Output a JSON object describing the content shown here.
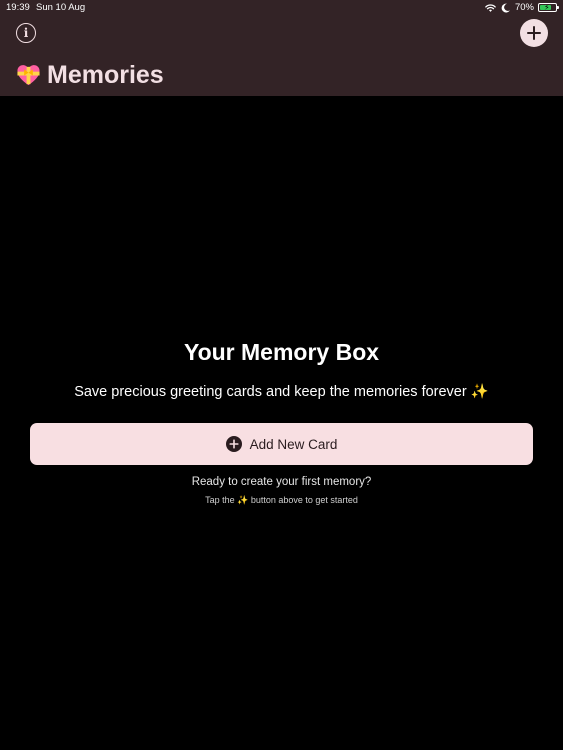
{
  "status_bar": {
    "time": "19:39",
    "date": "Sun 10 Aug",
    "battery": "70%",
    "battery_level": 0.7,
    "icons": [
      "wifi-icon",
      "moon-icon",
      "battery-charging-icon"
    ]
  },
  "nav": {
    "info_icon": "info-icon",
    "add_icon": "plus-icon",
    "title_emoji": "heart-with-ribbon-icon",
    "title": "Memories"
  },
  "empty_state": {
    "title": "Your Memory Box",
    "subtitle": "Save precious greeting cards and keep the memories forever ✨",
    "button_label": "Add New Card",
    "button_icon": "plus-circle-icon",
    "hint": "Ready to create your first memory?",
    "hint_detail": "Tap the ✨ button above to get started"
  },
  "colors": {
    "header_bg": "#332326",
    "accent_pink": "#f2dfe3",
    "button_bg": "#f8dfe2",
    "background": "#000000",
    "battery_green": "#34c759"
  }
}
